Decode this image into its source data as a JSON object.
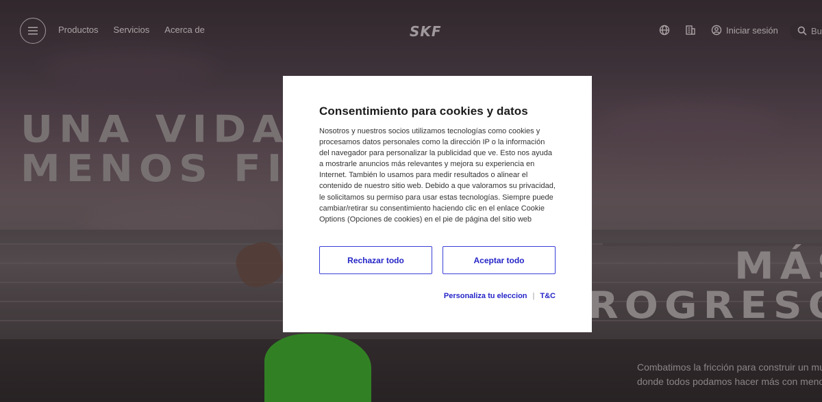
{
  "header": {
    "nav": [
      "Productos",
      "Servicios",
      "Acerca de"
    ],
    "logo": "SKF",
    "login_label": "Iniciar sesión",
    "search_placeholder": "Bu"
  },
  "hero": {
    "title_left": [
      "UNA VIDA",
      "MENOS FI"
    ],
    "title_right": [
      "MÁS",
      "ROGRESO"
    ],
    "subtitle": [
      "Combatimos la fricción para construir un mu",
      "donde todos podamos hacer más con menos"
    ]
  },
  "cookie_modal": {
    "title": "Consentimiento para cookies y datos",
    "body": "Nosotros y nuestros socios utilizamos tecnologías como cookies y procesamos datos personales como la dirección IP o la información del navegador para personalizar la publicidad que ve. Esto nos ayuda a mostrarle anuncios más relevantes y mejora su experiencia en Internet. También lo usamos para medir resultados o alinear el contenido de nuestro sitio web. Debido a que valoramos su privacidad, le solicitamos su permiso para usar estas tecnologías. Siempre puede cambiar/retirar su consentimiento haciendo clic en el enlace Cookie Options (Opciones de cookies) en el pie de página del sitio web",
    "reject_label": "Rechazar todo",
    "accept_label": "Aceptar todo",
    "customize_label": "Personaliza tu eleccion",
    "separator": "|",
    "tc_label": "T&C"
  },
  "icons": [
    "menu-icon",
    "globe-icon",
    "building-icon",
    "user-icon",
    "search-icon"
  ],
  "colors": {
    "accent": "#2424c8",
    "modal_bg": "#ffffff",
    "dress": "#3cae2c"
  }
}
